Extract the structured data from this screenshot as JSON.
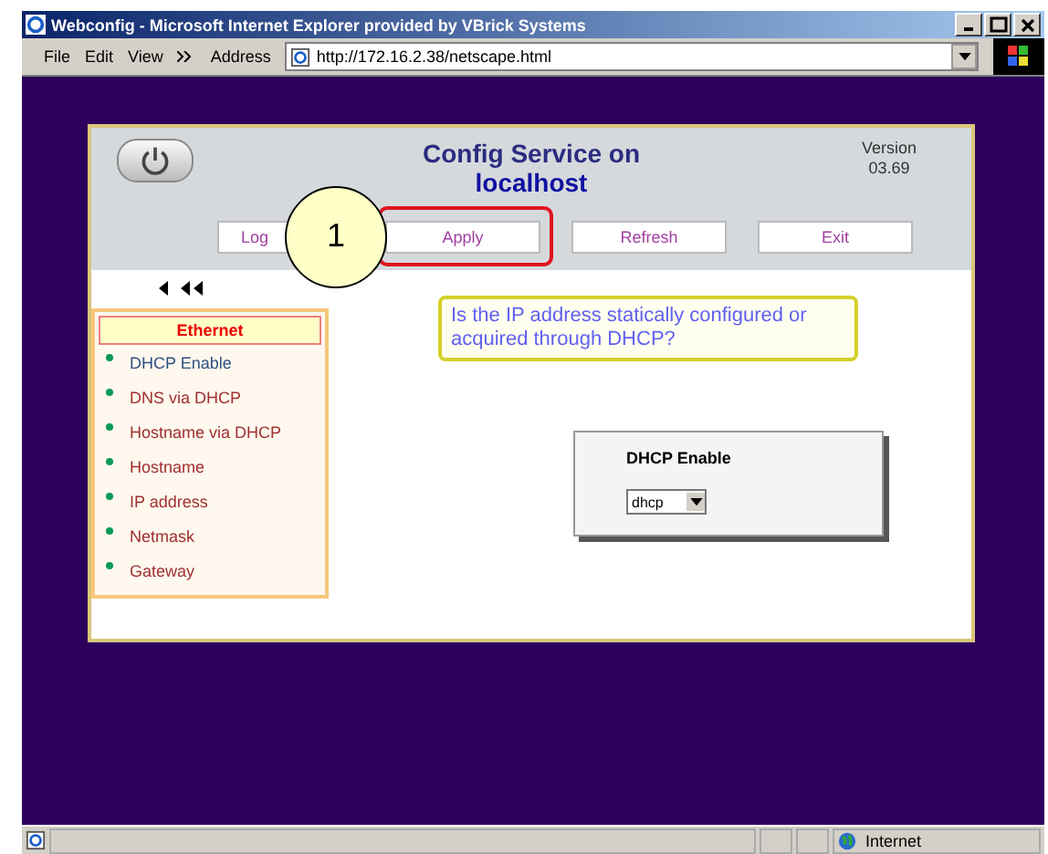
{
  "window": {
    "title": "Webconfig - Microsoft Internet Explorer provided by VBrick Systems"
  },
  "menu": [
    "File",
    "Edit",
    "View"
  ],
  "address": {
    "label": "Address",
    "value": "http://172.16.2.38/netscape.html"
  },
  "header": {
    "title": "Config Service on",
    "host": "localhost",
    "version_label": "Version",
    "version": "03.69"
  },
  "buttons": [
    {
      "label": "Log",
      "highlighted": false
    },
    {
      "label": "Apply",
      "highlighted": true
    },
    {
      "label": "Refresh",
      "highlighted": false
    },
    {
      "label": "Exit",
      "highlighted": false
    }
  ],
  "callout": {
    "number": "1"
  },
  "nav": {
    "heading": "Ethernet",
    "items": [
      {
        "label": "DHCP Enable",
        "selected": true
      },
      {
        "label": "DNS via DHCP",
        "selected": false
      },
      {
        "label": "Hostname via DHCP",
        "selected": false
      },
      {
        "label": "Hostname",
        "selected": false
      },
      {
        "label": "IP address",
        "selected": false
      },
      {
        "label": "Netmask",
        "selected": false
      },
      {
        "label": "Gateway",
        "selected": false
      }
    ]
  },
  "hint": "Is the IP address statically configured or acquired through DHCP?",
  "setting": {
    "label": "DHCP Enable",
    "value": "dhcp"
  },
  "status_bar": {
    "zone": "Internet"
  }
}
